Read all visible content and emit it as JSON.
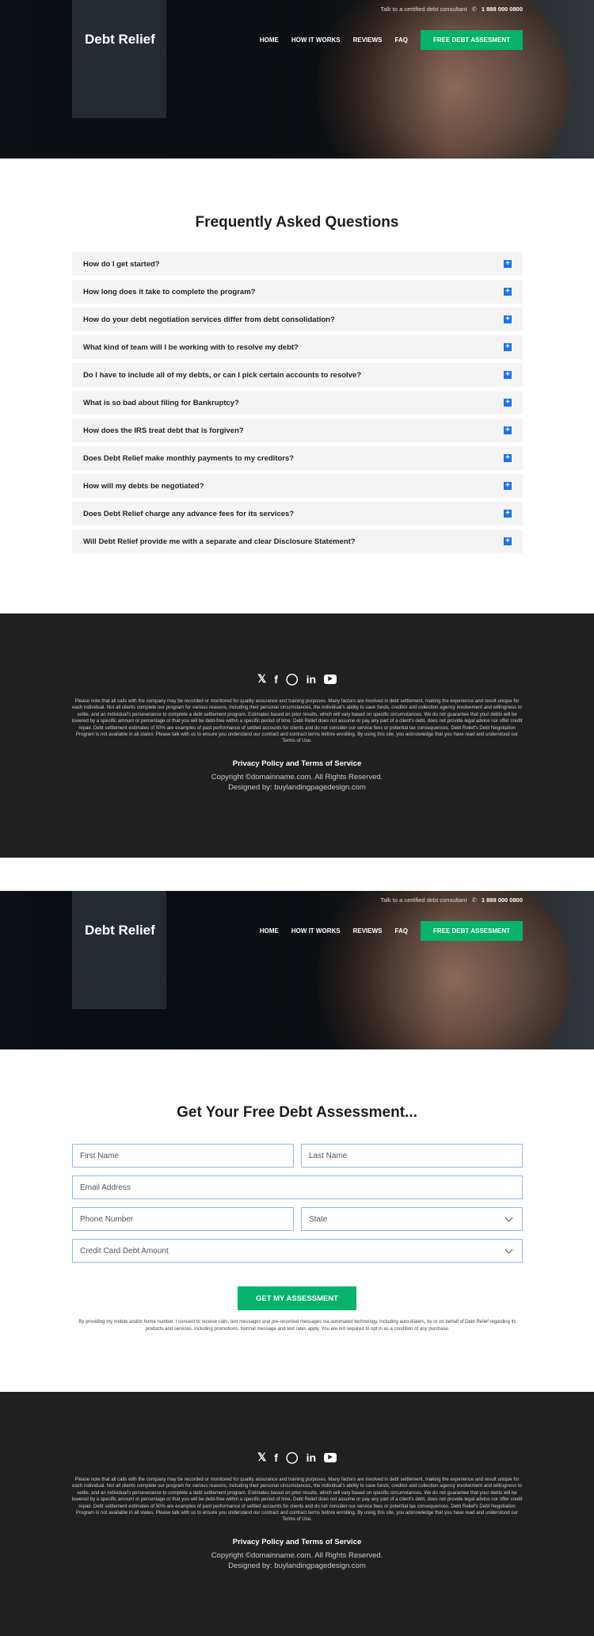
{
  "header": {
    "logo": "Debt Relief",
    "topbar_text": "Talk to a certified debt consultant",
    "phone": "1 888 000 0800",
    "nav": [
      "HOME",
      "HOW IT WORKS",
      "REVIEWS",
      "FAQ"
    ],
    "cta": "FREE DEBT ASSESMENT"
  },
  "faq": {
    "title": "Frequently Asked Questions",
    "items": [
      "How do I get started?",
      "How long does it take to complete the program?",
      "How do your debt negotiation services differ from debt consolidation?",
      "What kind of team will I be working with to resolve my debt?",
      "Do I have to include all of my debts, or can I pick certain accounts to resolve?",
      "What is so bad about filing for Bankruptcy?",
      "How does the IRS treat debt that is forgiven?",
      "Does Debt Relief make monthly payments to my creditors?",
      "How will my debts be negotiated?",
      "Does Debt Relief charge any advance fees for its services?",
      "Will Debt Relief provide me with a separate and clear Disclosure Statement?"
    ]
  },
  "footer": {
    "social": [
      "twitter",
      "facebook",
      "instagram",
      "linkedin",
      "youtube"
    ],
    "legal": "Please note that all calls with the company may be recorded or monitored for quality assurance and training purposes. Many factors are involved in debt settlement, making the experience and result unique for each individual. Not all clients complete our program for various reasons, including their personal circumstances, the individual's ability to save funds, creditor and collection agency involvement and willingness to settle, and an individual's perseverance to complete a debt settlement program. Estimates based on prior results, which will vary based on specific circumstances. We do not guarantee that your debts will be lowered by a specific amount or percentage or that you will be debt-free within a specific period of time. Debt Relief does not assume or pay any part of a client's debt, does not provide legal advice nor offer credit repair. Debt settlement estimates of 50% are examples of past performance of settled accounts for clients and do not consider our service fees or potential tax consequences. Debt Relief's Debt Negotiation Program is not available in all states. Please talk with us to ensure you understand our contract and contract terms before enrolling. By using this site, you acknowledge that you have read and understood our Terms of Use.",
    "policy": "Privacy Policy and Terms of Service",
    "copyright": "Copyright ©domainname.com. All Rights Reserved.",
    "designed": "Designed by: buylandingpagedesign.com"
  },
  "form": {
    "title": "Get Your Free Debt Assessment...",
    "first_name": "First Name",
    "last_name": "Last Name",
    "email": "Email Address",
    "phone": "Phone Number",
    "state": "State",
    "debt": "Credit Card Debt Amount",
    "submit": "GET MY ASSESSMENT",
    "disclaimer": "By providing my mobile and/or home number, I consent to receive calls, text messages and pre-recorded messages via automated technology, including auto-dialers, by or on behalf of Debt Relief regarding its products and services, including promotions. Normal message and text rates apply. You are not required to opt in as a condition of any purchase."
  },
  "colors": {
    "accent": "#07b26a",
    "plus": "#1a73e8",
    "footer_bg": "#202020",
    "field_border": "#8fb8f0"
  }
}
